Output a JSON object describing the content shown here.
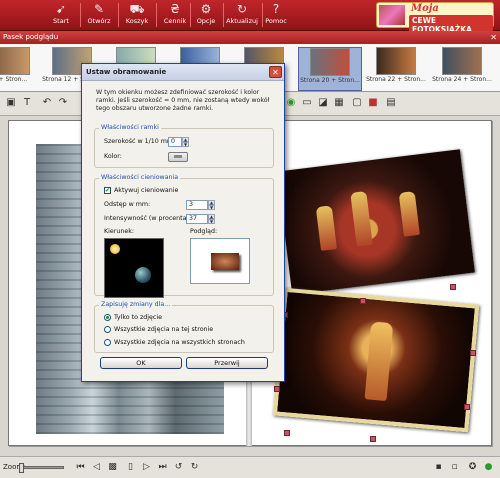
{
  "toolbar": {
    "items": [
      {
        "label": "Start",
        "icon": "rocket-icon"
      },
      {
        "label": "Otwórz",
        "icon": "open-icon"
      },
      {
        "label": "Koszyk",
        "icon": "cart-icon"
      },
      {
        "label": "Cennik",
        "icon": "price-icon"
      },
      {
        "label": "Opcje",
        "icon": "gear-icon"
      },
      {
        "label": "Aktualizuj",
        "icon": "refresh-icon"
      },
      {
        "label": "Pomoc",
        "icon": "help-icon"
      }
    ],
    "logo_line1": "Moja",
    "logo_line2": "CEWE FOTOKSIĄŻKA"
  },
  "preview_strip": {
    "title": "Pasek podglądu",
    "thumbs": [
      {
        "caption": "3 + Stron..."
      },
      {
        "caption": "Strona 12 + Stron..."
      },
      {
        "caption": ""
      },
      {
        "caption": ""
      },
      {
        "caption": ""
      },
      {
        "caption": "Strona 20 + Stron..."
      },
      {
        "caption": "Strona 22 + Stron..."
      },
      {
        "caption": "Strona 24 + Stron..."
      }
    ]
  },
  "dialog": {
    "title": "Ustaw obramowanie",
    "intro": "W tym okienku możesz zdefiniować szerokość i kolor ramki. Jeśli szerokość = 0 mm, nie zostaną wtedy wokół tego obszaru utworzone żadne ramki.",
    "frame_group": {
      "title": "Właściwości ramki",
      "width_label": "Szerokość w 1/10 mm:",
      "width_value": "0",
      "color_label": "Kolor:"
    },
    "shadow_group": {
      "title": "Właściwości cieniowania",
      "enable_label": "Aktywuj cieniowanie",
      "enable_checked": true,
      "offset_label": "Odstęp w mm:",
      "offset_value": "3",
      "intensity_label": "Intensywność (w procentach):",
      "intensity_value": "37",
      "direction_label": "Kierunek:",
      "preview_label": "Podgląd:"
    },
    "save_group": {
      "title": "Zapisuję zmiany dla...",
      "options": [
        {
          "label": "Tylko to zdjęcie",
          "selected": true
        },
        {
          "label": "Wszystkie zdjęcia na tej stronie",
          "selected": false
        },
        {
          "label": "Wszystkie zdjęcia na wszystkich stronach",
          "selected": false
        }
      ]
    },
    "ok_label": "OK",
    "cancel_label": "Przerwij"
  },
  "status": {
    "zoom_label": "Zoom:"
  }
}
